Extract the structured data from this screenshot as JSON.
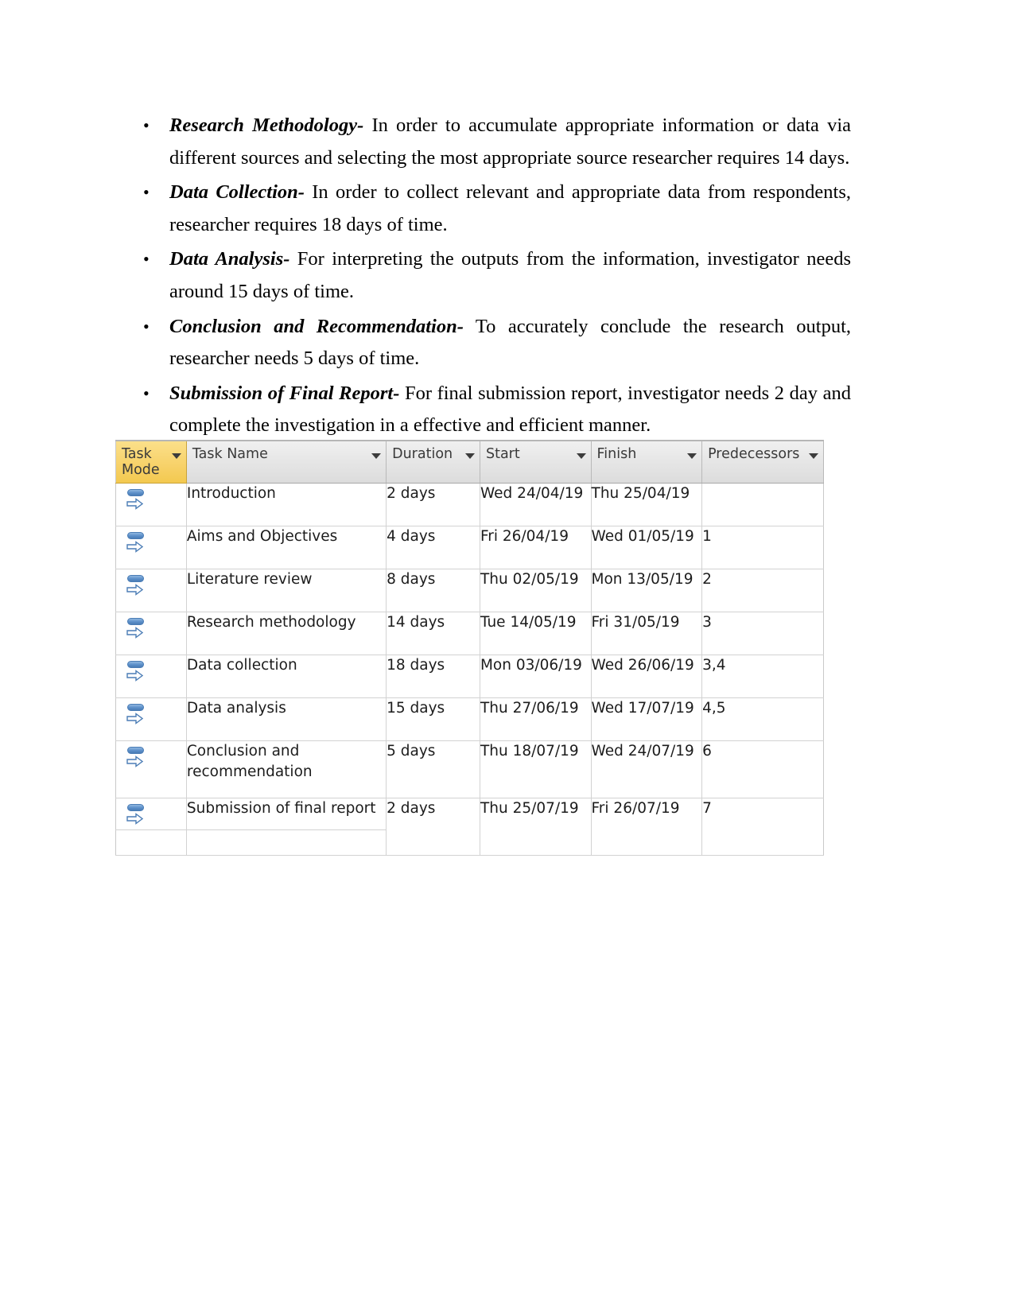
{
  "document": {
    "bullets": [
      {
        "lead": "Research Methodology-",
        "body": " In order to accumulate appropriate information or data via different sources and selecting the most appropriate source researcher requires 14 days."
      },
      {
        "lead": "Data Collection-",
        "body": " In order to collect relevant and appropriate data from respondents, researcher requires 18 days of time."
      },
      {
        "lead": "Data Analysis-",
        "body": " For interpreting the outputs from the information, investigator needs around 15 days of time."
      },
      {
        "lead": "Conclusion and Recommendation-",
        "body": " To accurately conclude the research output, researcher needs 5 days of time."
      },
      {
        "lead": "Submission of Final Report-",
        "body": " For final submission report, investigator needs 2 day and complete the investigation in a effective and efficient manner."
      }
    ],
    "bullet_marker": "•"
  },
  "gantt_table": {
    "colors": {
      "task_mode_header": "#F7D168",
      "header_background": "#E2E2E2",
      "grid_line": "#D2D2D2",
      "icon_blue": "#4A7CB5"
    },
    "columns": [
      {
        "key": "task_mode",
        "label": "Task\nMode",
        "has_filter": true
      },
      {
        "key": "task_name",
        "label": "Task Name",
        "has_filter": true
      },
      {
        "key": "duration",
        "label": "Duration",
        "has_filter": true
      },
      {
        "key": "start",
        "label": "Start",
        "has_filter": true
      },
      {
        "key": "finish",
        "label": "Finish",
        "has_filter": true
      },
      {
        "key": "predecessors",
        "label": "Predecessors",
        "has_filter": true
      }
    ],
    "filter_icon": "chevron-down-icon",
    "task_mode_icon": "auto-scheduled-icon",
    "rows": [
      {
        "task_mode": "auto-scheduled-icon",
        "task_name": "Introduction",
        "duration": "2 days",
        "start": "Wed 24/04/19",
        "finish": "Thu 25/04/19",
        "predecessors": ""
      },
      {
        "task_mode": "auto-scheduled-icon",
        "task_name": "Aims and Objectives",
        "duration": "4 days",
        "start": "Fri 26/04/19",
        "finish": "Wed 01/05/19",
        "predecessors": "1"
      },
      {
        "task_mode": "auto-scheduled-icon",
        "task_name": "Literature review",
        "duration": "8 days",
        "start": "Thu 02/05/19",
        "finish": "Mon 13/05/19",
        "predecessors": "2"
      },
      {
        "task_mode": "auto-scheduled-icon",
        "task_name": "Research methodology",
        "duration": "14 days",
        "start": "Tue 14/05/19",
        "finish": "Fri 31/05/19",
        "predecessors": "3"
      },
      {
        "task_mode": "auto-scheduled-icon",
        "task_name": "Data collection",
        "duration": "18 days",
        "start": "Mon 03/06/19",
        "finish": "Wed 26/06/19",
        "predecessors": "3,4"
      },
      {
        "task_mode": "auto-scheduled-icon",
        "task_name": "Data analysis",
        "duration": "15 days",
        "start": "Thu 27/06/19",
        "finish": "Wed 17/07/19",
        "predecessors": "4,5"
      },
      {
        "task_mode": "auto-scheduled-icon",
        "task_name": "Conclusion and recommendation",
        "duration": "5 days",
        "start": "Thu 18/07/19",
        "finish": "Wed 24/07/19",
        "predecessors": "6"
      },
      {
        "task_mode": "auto-scheduled-icon",
        "task_name": "Submission of final report",
        "duration": "2 days",
        "start": "Thu 25/07/19",
        "finish": "Fri 26/07/19",
        "predecessors": "7"
      }
    ]
  }
}
